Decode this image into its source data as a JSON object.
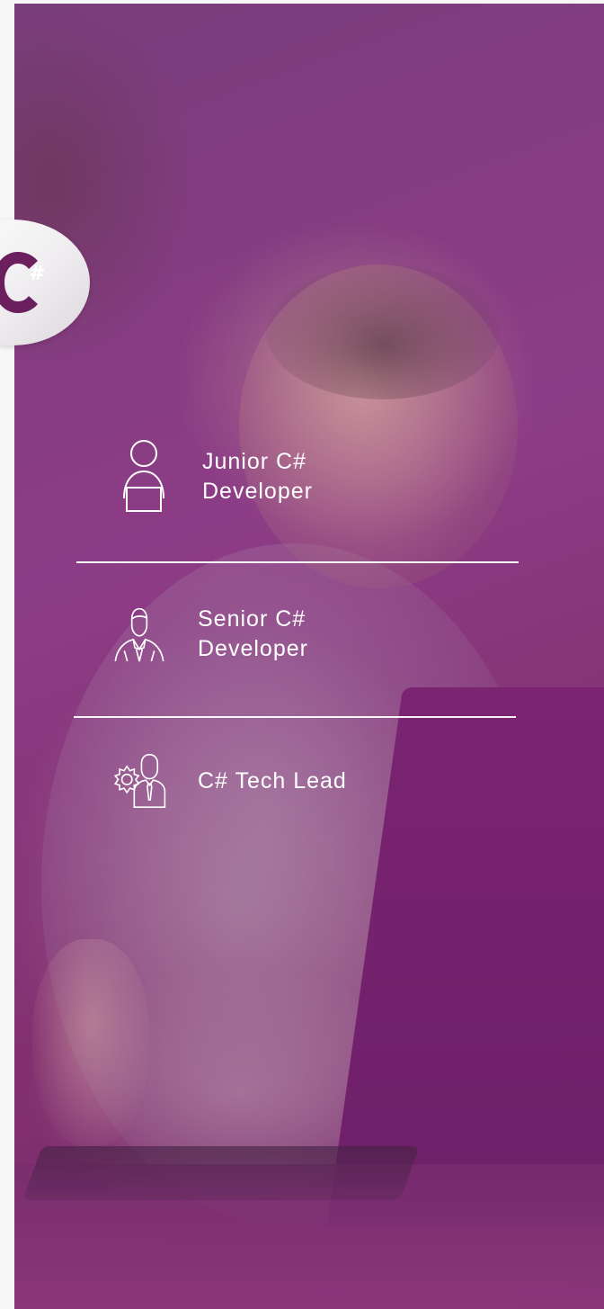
{
  "badge": {
    "letter": "C",
    "symbol": "#",
    "brand_color": "#6b1f5e"
  },
  "roles": [
    {
      "label": "Junior C#\nDeveloper",
      "icon": "person-laptop-icon"
    },
    {
      "label": "Senior C#\nDeveloper",
      "icon": "person-suit-icon"
    },
    {
      "label": "C# Tech Lead",
      "icon": "person-gear-tie-icon"
    }
  ],
  "colors": {
    "overlay": "#8d3c86",
    "text": "#ffffff"
  }
}
